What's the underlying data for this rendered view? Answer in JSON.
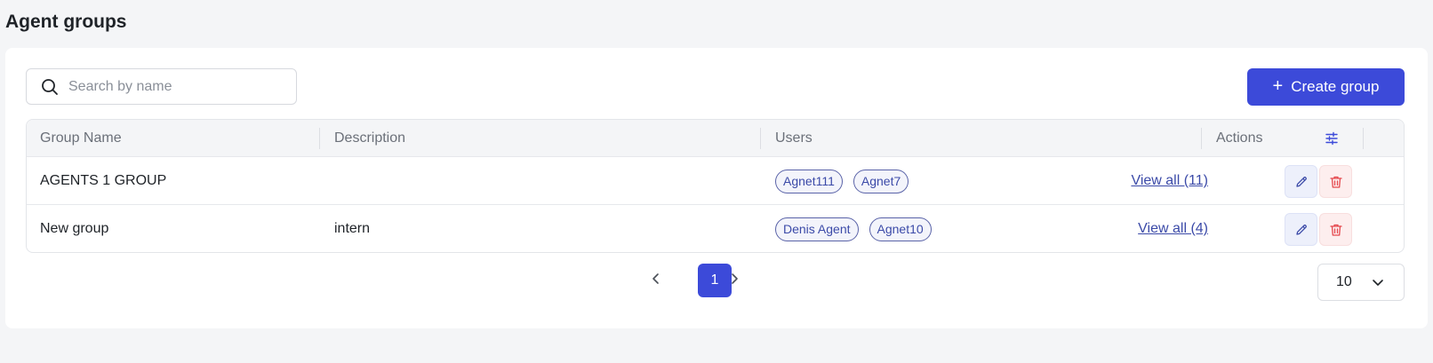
{
  "page": {
    "title": "Agent groups"
  },
  "search": {
    "placeholder": "Search by name",
    "value": ""
  },
  "toolbar": {
    "create_label": "Create group"
  },
  "table": {
    "columns": [
      "Group Name",
      "Description",
      "Users",
      "Actions"
    ],
    "rows": [
      {
        "name": "AGENTS 1 GROUP",
        "description": "",
        "users": [
          "Agnet111",
          "Agnet7"
        ],
        "view_all": "View all (11)"
      },
      {
        "name": "New group",
        "description": "intern",
        "users": [
          "Denis Agent",
          "Agnet10"
        ],
        "view_all": "View all (4)"
      }
    ]
  },
  "pagination": {
    "current_page": "1",
    "page_size": "10"
  },
  "colors": {
    "accent": "#3c4ad9",
    "link": "#3b4aa8",
    "danger": "#e5484d"
  },
  "icons": [
    "search-icon",
    "plus-icon",
    "column-settings-icon",
    "edit-icon",
    "trash-icon",
    "chevron-left-icon",
    "chevron-right-icon",
    "chevron-down-icon"
  ]
}
